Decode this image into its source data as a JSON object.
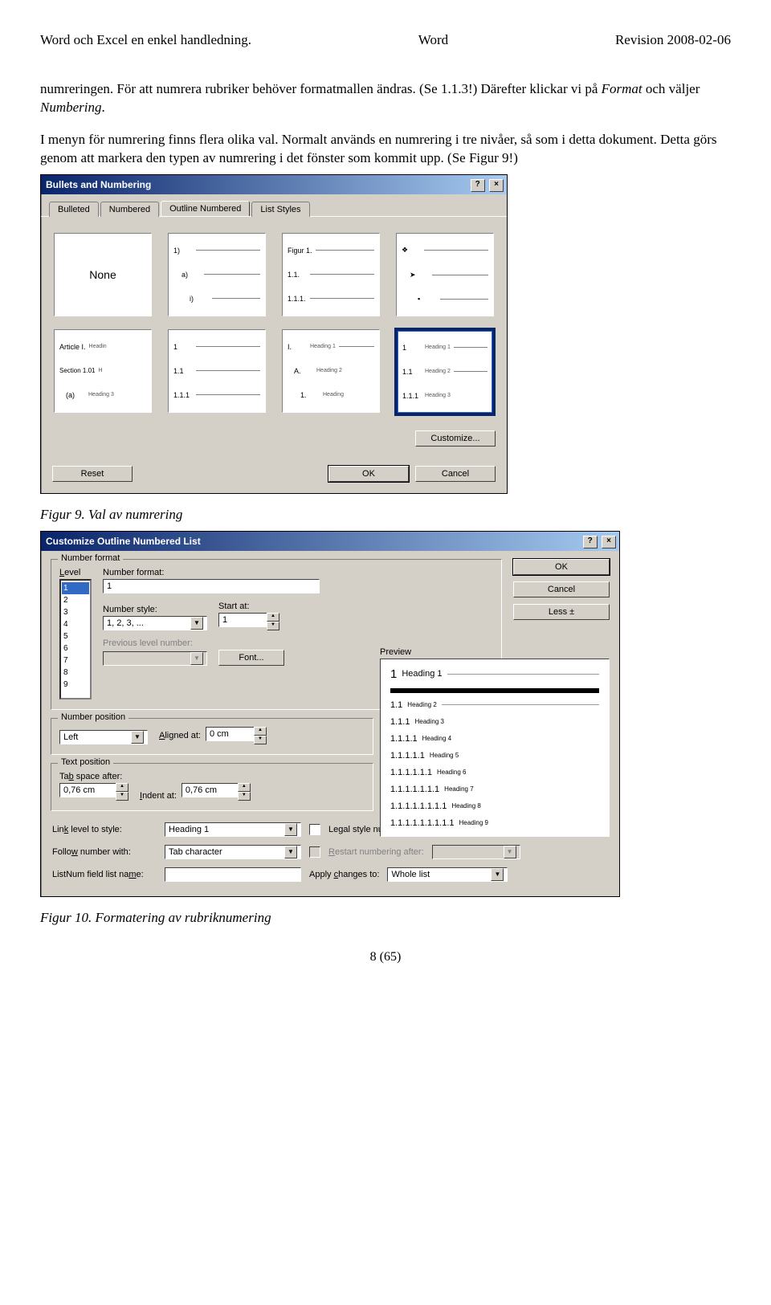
{
  "header": {
    "left": "Word och Excel en enkel handledning.",
    "center": "Word",
    "right": "Revision 2008-02-06"
  },
  "para1_a": "numreringen. För att numrera rubriker behöver formatmallen ändras. (Se 1.1.3!) Därefter klickar vi på ",
  "para1_b": "Format",
  "para1_c": " och väljer ",
  "para1_d": "Numbering",
  "para1_e": ".",
  "para2": "I menyn för numrering finns flera olika val. Normalt används en numrering i tre nivåer, så som i detta dokument. Detta görs genom att markera den typen av numrering i det fönster som kommit upp. (Se Figur 9!)",
  "dialog1": {
    "title": "Bullets and Numbering",
    "tabs": {
      "t1": "Bulleted",
      "t2": "Numbered",
      "t3": "Outline Numbered",
      "t4": "List Styles"
    },
    "none": "None",
    "thumbs": {
      "r1c2": {
        "a": "1)",
        "b": "a)",
        "c": "i)"
      },
      "r1c3": {
        "a": "Figur 1.",
        "b": "1.1.",
        "c": "1.1.1."
      },
      "r1c4": {
        "a": "❖",
        "b": "➤",
        "c": "▪"
      },
      "r2c1": {
        "a": "Article I.",
        "a2": "Headin",
        "b": "Section 1.01",
        "b2": "H",
        "c": "(a)",
        "c2": "Heading 3"
      },
      "r2c2": {
        "a": "1",
        "b": "1.1",
        "c": "1.1.1"
      },
      "r2c3": {
        "a": "I.",
        "a2": "Heading 1",
        "b": "A.",
        "b2": "Heading 2",
        "c": "1.",
        "c2": "Heading"
      },
      "r2c4": {
        "a": "1",
        "a2": "Heading 1",
        "b": "1.1",
        "b2": "Heading 2",
        "c": "1.1.1",
        "c2": "Heading 3"
      }
    },
    "customize": "Customize...",
    "reset": "Reset",
    "ok": "OK",
    "cancel": "Cancel"
  },
  "caption1": "Figur 9. Val av numrering",
  "dialog2": {
    "title": "Customize Outline Numbered List",
    "groups": {
      "nf": "Number format",
      "np": "Number position",
      "tp": "Text position"
    },
    "labels": {
      "level": "Level",
      "number_format": "Number format:",
      "number_style": "Number style:",
      "start_at": "Start at:",
      "prev": "Previous level number:",
      "font": "Font...",
      "aligned_at": "Aligned at:",
      "tab_space": "Tab space after:",
      "indent_at": "Indent at:",
      "preview": "Preview",
      "link_level": "Link level to style:",
      "follow_with": "Follow number with:",
      "listnum": "ListNum field list name:",
      "legal": "Legal style numbering",
      "restart": "Restart numbering after:",
      "apply": "Apply changes to:"
    },
    "values": {
      "levels": [
        "1",
        "2",
        "3",
        "4",
        "5",
        "6",
        "7",
        "8",
        "9"
      ],
      "number_format": "1",
      "number_style": "1, 2, 3, ...",
      "start_at": "1",
      "pos_align": "Left",
      "aligned_at": "0 cm",
      "tab_space": "0,76 cm",
      "indent_at": "0,76 cm",
      "link_level": "Heading 1",
      "follow_with": "Tab character",
      "listnum": "",
      "apply": "Whole list"
    },
    "buttons": {
      "ok": "OK",
      "cancel": "Cancel",
      "less": "Less  ±"
    },
    "preview": {
      "l1": {
        "n": "1",
        "t": "Heading 1"
      },
      "l2": {
        "n": "1.1",
        "t": "Heading 2"
      },
      "l3": {
        "n": "1.1.1",
        "t": "Heading 3"
      },
      "l4": {
        "n": "1.1.1.1",
        "t": "Heading 4"
      },
      "l5": {
        "n": "1.1.1.1.1",
        "t": "Heading 5"
      },
      "l6": {
        "n": "1.1.1.1.1.1",
        "t": "Heading 6"
      },
      "l7": {
        "n": "1.1.1.1.1.1.1",
        "t": "Heading 7"
      },
      "l8": {
        "n": "1.1.1.1.1.1.1.1",
        "t": "Heading 8"
      },
      "l9": {
        "n": "1.1.1.1.1.1.1.1.1",
        "t": "Heading 9"
      }
    }
  },
  "caption2": "Figur 10. Formatering av rubriknumering",
  "pagenum": "8 (65)"
}
